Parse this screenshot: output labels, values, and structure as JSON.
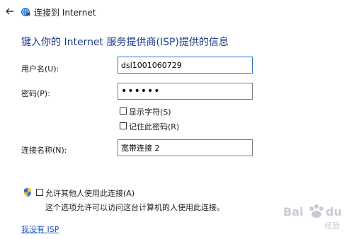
{
  "window": {
    "title": "连接到 Internet"
  },
  "heading": "键入你的 Internet 服务提供商(ISP)提供的信息",
  "form": {
    "username": {
      "label": "用户名(U):",
      "value": "dsl1001060729"
    },
    "password": {
      "label": "密码(P):",
      "value": "••••••"
    },
    "show_chars": {
      "label": "显示字符(S)",
      "checked": false
    },
    "remember_password": {
      "label": "记住此密码(R)",
      "checked": false
    },
    "connection_name": {
      "label": "连接名称(N):",
      "value": "宽带连接 2"
    },
    "allow_others": {
      "label": "允许其他人使用此连接(A)",
      "checked": false,
      "note": "这个选项允许可以访问这台计算机的人使用此连接。"
    }
  },
  "link": {
    "label": "我没有 ISP"
  },
  "watermark": {
    "logo_text": "Bai du 经验"
  },
  "colors": {
    "heading": "#1e3a8a",
    "link": "#1e5bc6",
    "focus_border": "#2b6bd4",
    "shield_blue": "#2f6fd6",
    "shield_yellow": "#f2c230"
  },
  "icons": {
    "back": "arrow-left-icon",
    "title": "network-globe-icon",
    "shield": "uac-shield-icon"
  }
}
